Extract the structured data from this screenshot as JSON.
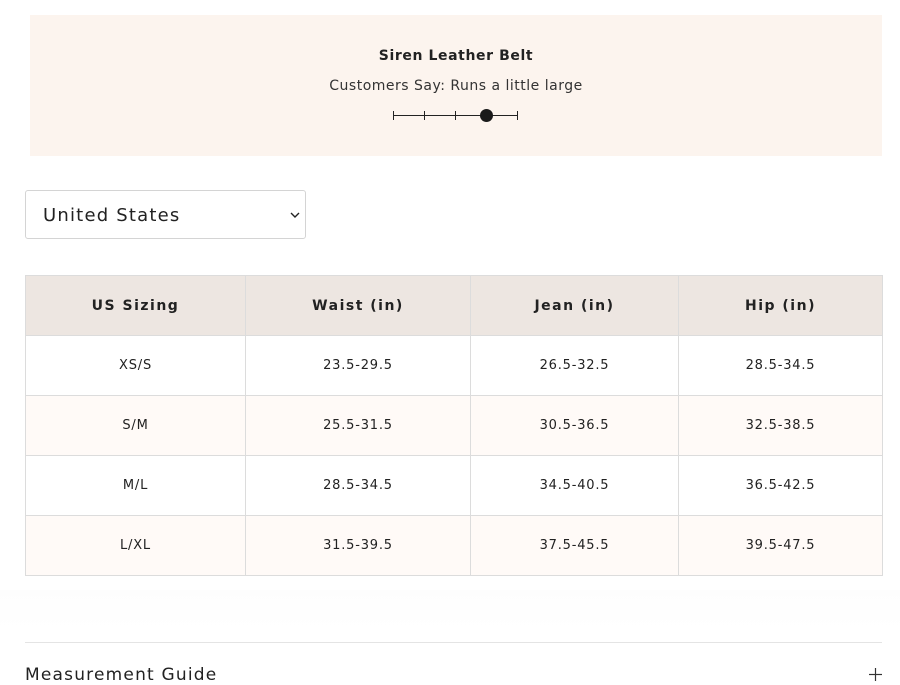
{
  "fit": {
    "product_name": "Siren Leather Belt",
    "customer_note": "Customers Say: Runs a little large",
    "scale_points": 5,
    "scale_value": 4
  },
  "region_select": {
    "value": "United States",
    "icon": "chevron-down-icon"
  },
  "size_table": {
    "headers": [
      "US Sizing",
      "Waist (in)",
      "Jean (in)",
      "Hip (in)"
    ],
    "rows": [
      [
        "XS/S",
        "23.5-29.5",
        "26.5-32.5",
        "28.5-34.5"
      ],
      [
        "S/M",
        "25.5-31.5",
        "30.5-36.5",
        "32.5-38.5"
      ],
      [
        "M/L",
        "28.5-34.5",
        "34.5-40.5",
        "36.5-42.5"
      ],
      [
        "L/XL",
        "31.5-39.5",
        "37.5-45.5",
        "39.5-47.5"
      ]
    ]
  },
  "accordion": {
    "title": "Measurement Guide",
    "icon": "plus-icon"
  }
}
